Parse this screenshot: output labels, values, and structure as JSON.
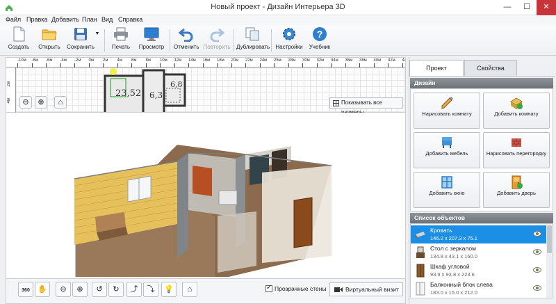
{
  "window": {
    "title": "Новый проект - Дизайн Интерьера 3D",
    "minimize": "—",
    "maximize": "☐",
    "close": "✕"
  },
  "menu": [
    "Файл",
    "Правка",
    "Добавить",
    "План",
    "Вид",
    "Справка"
  ],
  "toolbar": {
    "create": "Создать",
    "open": "Открыть",
    "save": "Сохранить",
    "print": "Печать",
    "preview": "Просмотр",
    "undo": "Отменить",
    "redo": "Повторить",
    "duplicate": "Дублировать",
    "settings": "Настройки",
    "tutorial": "Учебник"
  },
  "plan": {
    "ruler_labels": [
      "-10м",
      "-8м",
      "-6м",
      "-4м",
      "-2м",
      "0м",
      "2м",
      "4м",
      "6м",
      "8м",
      "10м",
      "12м",
      "14м",
      "16м",
      "18м",
      "20м",
      "22м",
      "24м",
      "26м",
      "28м",
      "30м",
      "32м",
      "34м",
      "36м",
      "38м",
      "40м",
      "42м",
      "44м"
    ],
    "ruler_v_labels": [
      "2м",
      "4м"
    ],
    "room_labels": [
      "23,52",
      "6,3",
      "6,8"
    ],
    "show_all_sizes": "Показывать все размеры"
  },
  "view3d": {
    "transparent_walls": "Прозрачные стены",
    "virtual_visit": "Виртуальный визит",
    "rotate_360": "360"
  },
  "panel": {
    "tab_project": "Проект",
    "tab_properties": "Свойства",
    "design_header": "Дизайн",
    "objects_header": "Список объектов",
    "buttons": [
      {
        "label": "Нарисовать комнату",
        "icon": "pencil-room-icon"
      },
      {
        "label": "Добавить комнату",
        "icon": "add-room-icon"
      },
      {
        "label": "Добавить мебель",
        "icon": "furniture-icon"
      },
      {
        "label": "Нарисовать перегородку",
        "icon": "partition-icon"
      },
      {
        "label": "Добавить окно",
        "icon": "window-icon"
      },
      {
        "label": "Добавить дверь",
        "icon": "door-icon"
      }
    ]
  },
  "objects": [
    {
      "name": "Кровать",
      "dims": "146.2 x 207.3 x 75.1",
      "selected": true
    },
    {
      "name": "Стол с зеркалом",
      "dims": "134.8 x 43.1 x 160.0",
      "selected": false
    },
    {
      "name": "Шкаф угловой",
      "dims": "93.9 x 93.8 x 223.6",
      "selected": false
    },
    {
      "name": "Балконный блок слева",
      "dims": "183.0 x 15.0 x 212.0",
      "selected": false
    }
  ],
  "colors": {
    "selection": "#1b8fe6",
    "section_header": "#7a7f86",
    "close_button": "#c7353a",
    "brick": "#e8c15c",
    "floor_wood": "#8a6a4e"
  }
}
